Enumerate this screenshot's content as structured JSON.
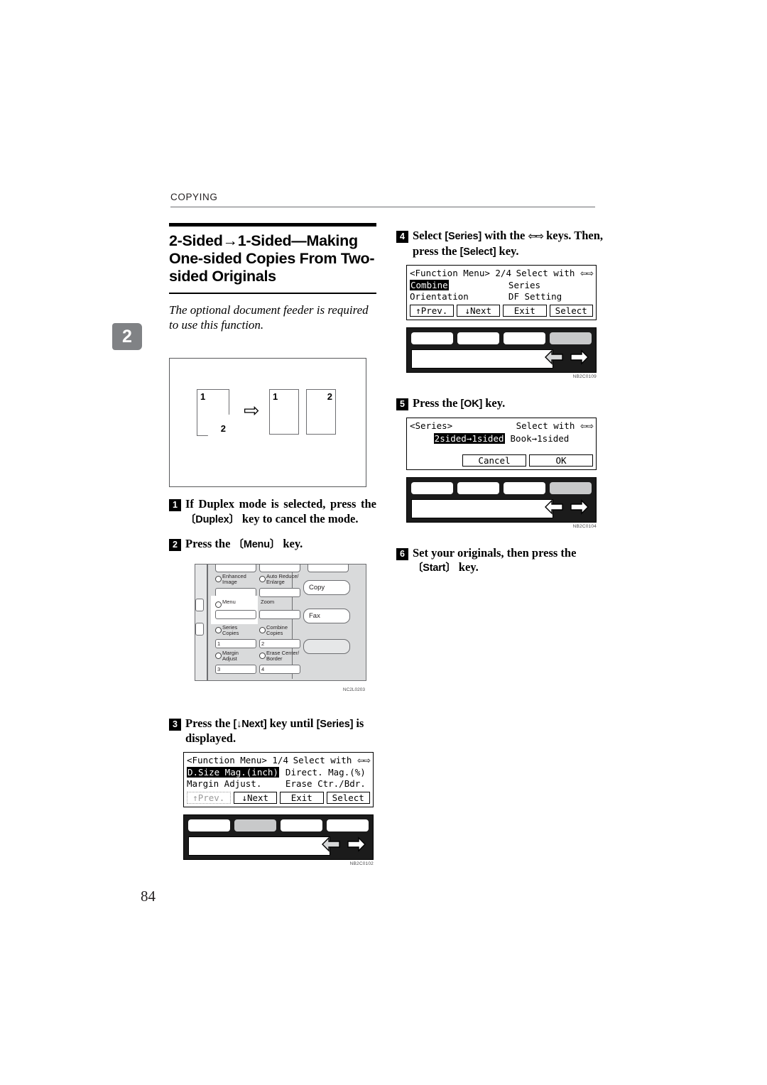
{
  "page": {
    "running_head": "COPYING",
    "chapter_tab": "2",
    "page_number": "84"
  },
  "section": {
    "title_line1": "2-Sided→1-Sided—Making",
    "title_line2": "One-sided Copies From Two-",
    "title_line3": "sided Originals",
    "lead": "The optional document feeder is required to use this function."
  },
  "illustration": {
    "original_front": "1",
    "original_back": "2",
    "copy_first": "1",
    "copy_second": "2",
    "transform_arrow": "⇨"
  },
  "steps": [
    {
      "number": "1",
      "text_a": "If Duplex mode is selected, press the ",
      "key": "〔Duplex〕",
      "text_b": " key to cancel the mode."
    },
    {
      "number": "2",
      "text_a": "Press the ",
      "key": "〔Menu〕",
      "text_b": " key."
    },
    {
      "number": "3",
      "text_a": "Press the ",
      "key": "[↓Next]",
      "text_b": " key until ",
      "key2": "[Series]",
      "text_c": " is displayed."
    },
    {
      "number": "4",
      "text_a": "Select ",
      "key": "[Series]",
      "text_b": " with the ",
      "arrows": "⇦⇨",
      "text_c": " keys. Then, press the ",
      "key2": "[Select]",
      "text_d": " key."
    },
    {
      "number": "5",
      "text_a": "Press the ",
      "key": "[OK]",
      "text_b": " key."
    },
    {
      "number": "6",
      "text_a": "Set your originals, then press the ",
      "key": "〔Start〕",
      "text_b": " key."
    }
  ],
  "oppanel": {
    "keys": [
      {
        "label_line1": "Enhanced",
        "label_line2": "Image",
        "number": ""
      },
      {
        "label_line1": "Auto Reduce/",
        "label_line2": "Enlarge",
        "number": ""
      },
      {
        "label_line1": "Menu",
        "label_line2": "",
        "number": ""
      },
      {
        "label_line1": "Zoom",
        "label_line2": "",
        "number": ""
      },
      {
        "label_line1": "Series",
        "label_line2": "Copies",
        "number": "1"
      },
      {
        "label_line1": "Combine",
        "label_line2": "Copies",
        "number": "2"
      },
      {
        "label_line1": "Margin",
        "label_line2": "Adjust",
        "number": "3"
      },
      {
        "label_line1": "Erase Center/",
        "label_line2": "Border",
        "number": "4"
      }
    ],
    "mode_keys": [
      "Copy",
      "Fax",
      ""
    ],
    "fig_code": "NC2L0203"
  },
  "lcd_step3": {
    "header_left": "<Function Menu> 1/4",
    "header_right": "Select with ",
    "header_arrows": "⇦⇨",
    "items": [
      {
        "label": "D.Size Mag.(inch)",
        "selected": true
      },
      {
        "label": "Direct. Mag.(%)",
        "selected": false
      },
      {
        "label": "Margin Adjust.",
        "selected": false
      },
      {
        "label": "Erase Ctr./Bdr.",
        "selected": false
      }
    ],
    "buttons": [
      {
        "label": "↑Prev.",
        "state": "disabled"
      },
      {
        "label": "↓Next",
        "state": "normal"
      },
      {
        "label": "Exit",
        "state": "normal"
      },
      {
        "label": "Select",
        "state": "normal"
      }
    ],
    "fig_code": "NB2C0102"
  },
  "lcd_step4": {
    "header_left": "<Function Menu> 2/4",
    "header_right": "Select with ",
    "header_arrows": "⇦⇨",
    "items": [
      {
        "label": "Combine",
        "selected": true
      },
      {
        "label": "Series",
        "selected": false
      },
      {
        "label": "Orientation",
        "selected": false
      },
      {
        "label": "DF Setting",
        "selected": false
      }
    ],
    "buttons": [
      {
        "label": "↑Prev.",
        "state": "normal"
      },
      {
        "label": "↓Next",
        "state": "normal"
      },
      {
        "label": "Exit",
        "state": "normal"
      },
      {
        "label": "Select",
        "state": "normal"
      }
    ],
    "fig_code": "NB2C0109"
  },
  "lcd_step5": {
    "header_left": "<Series>",
    "header_right": "Select with ",
    "header_arrows": "⇦⇨",
    "items": [
      {
        "label": "2sided→1sided",
        "selected": true
      },
      {
        "label": "Book→1sided",
        "selected": false
      }
    ],
    "buttons": [
      {
        "label": "Cancel",
        "state": "normal"
      },
      {
        "label": "OK",
        "state": "normal"
      }
    ],
    "fig_code": "NB2C0104"
  }
}
